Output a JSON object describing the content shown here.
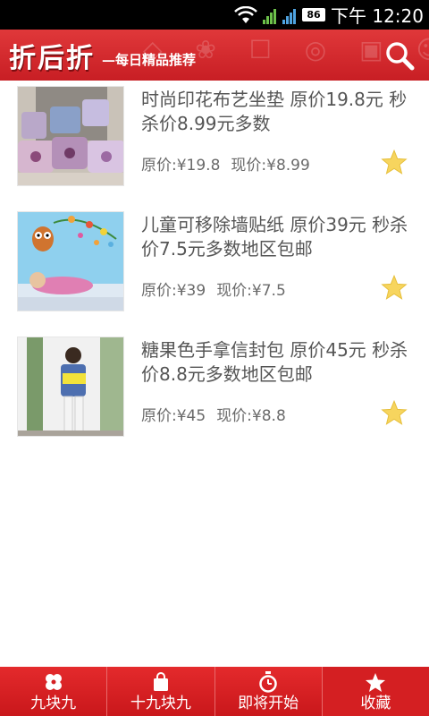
{
  "status_bar": {
    "time": "下午 12:20",
    "battery": "86",
    "icons": [
      "wifi-icon",
      "signal-green-icon",
      "signal-blue-icon",
      "battery-icon"
    ]
  },
  "header": {
    "title": "折后折",
    "subtitle": "—每日精品推荐",
    "search_icon": "search-icon",
    "background_color": "#d62a2d"
  },
  "products": [
    {
      "title": "时尚印花布艺坐垫 原价19.8元 秒杀价8.99元多数",
      "original_price": "原价:¥19.8",
      "current_price": "现价:¥8.99",
      "thumb": "cushions-photo"
    },
    {
      "title": "儿童可移除墙贴纸 原价39元 秒杀价7.5元多数地区包邮",
      "original_price": "原价:¥39",
      "current_price": "现价:¥7.5",
      "thumb": "wall-sticker-photo"
    },
    {
      "title": "糖果色手拿信封包 原价45元 秒杀价8.8元多数地区包邮",
      "original_price": "原价:¥45",
      "current_price": "现价:¥8.8",
      "thumb": "clutch-bag-photo"
    }
  ],
  "bottom_nav": {
    "tabs": [
      {
        "label": "九块九",
        "icon": "clover-icon"
      },
      {
        "label": "十九块九",
        "icon": "shopping-bag-icon"
      },
      {
        "label": "即将开始",
        "icon": "stopwatch-icon"
      },
      {
        "label": "收藏",
        "icon": "star-icon"
      }
    ],
    "selected": "收藏"
  },
  "colors": {
    "accent": "#d62a2d",
    "star": "#f7d55e",
    "text": "#555555"
  }
}
